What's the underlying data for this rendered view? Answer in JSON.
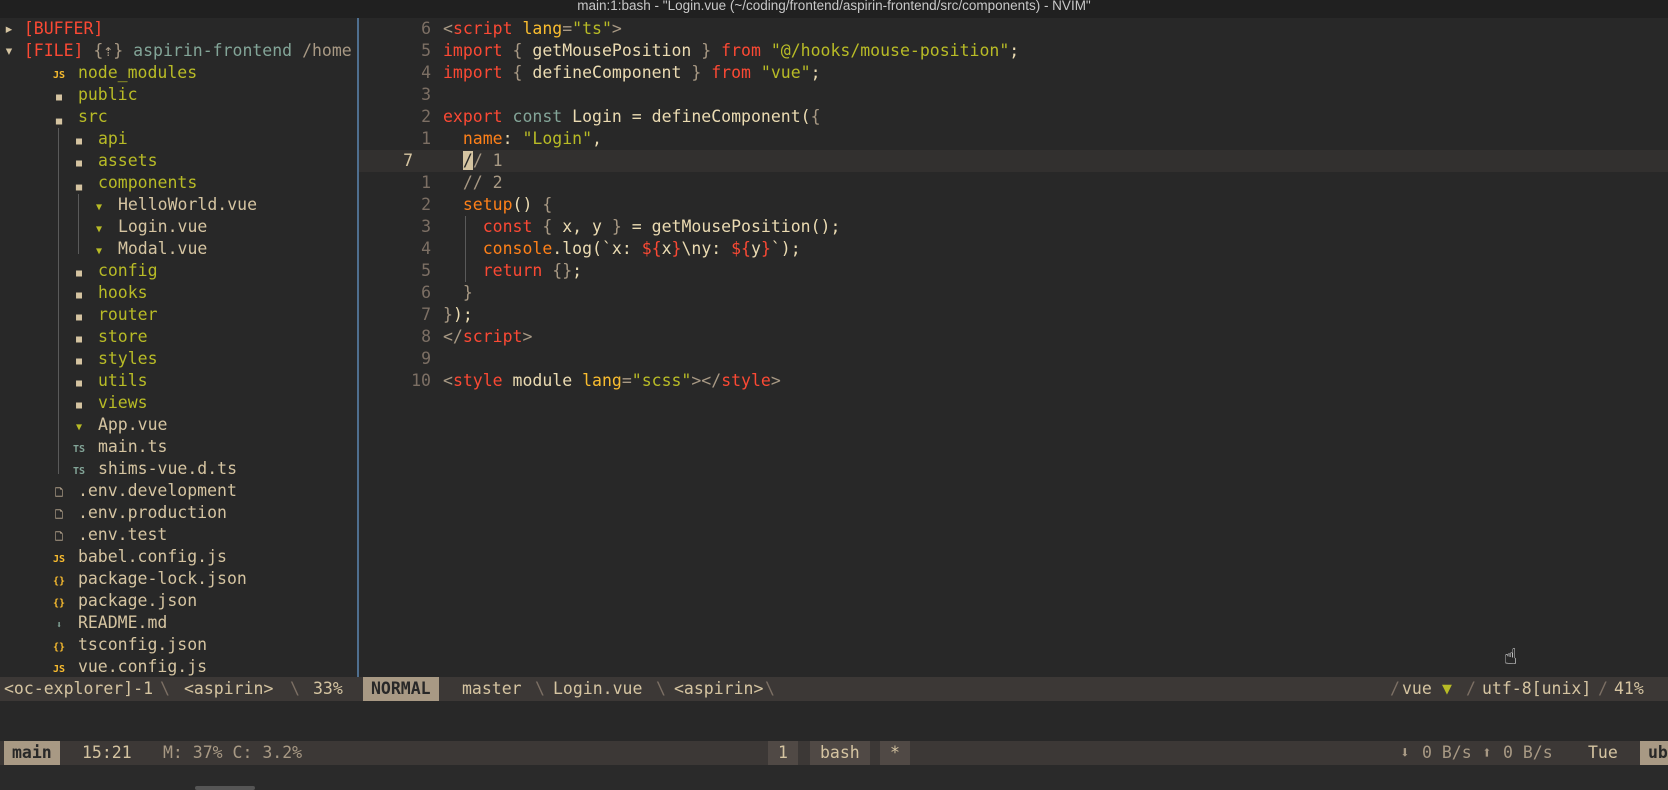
{
  "titlebar": {
    "title": "main:1:bash - \"Login.vue (~/coding/frontend/aspirin-frontend/src/components) - NVIM\""
  },
  "explorer": {
    "buffer_label": "[BUFFER]",
    "file_label": "[FILE]",
    "file_flags": "{⇡}",
    "project": "aspirin-frontend",
    "project_path": "/home",
    "items": [
      {
        "name": "node_modules",
        "icon": "JS",
        "kind": "js-folder"
      },
      {
        "name": "public",
        "icon": "folder-icon",
        "kind": "folder"
      },
      {
        "name": "src",
        "icon": "folder-open-icon",
        "kind": "folder"
      },
      {
        "name": "api",
        "icon": "folder-icon",
        "kind": "folder"
      },
      {
        "name": "assets",
        "icon": "folder-icon",
        "kind": "folder"
      },
      {
        "name": "components",
        "icon": "folder-open-icon",
        "kind": "folder"
      },
      {
        "name": "HelloWorld.vue",
        "icon": "vue-icon",
        "kind": "vue"
      },
      {
        "name": "Login.vue",
        "icon": "vue-icon",
        "kind": "vue"
      },
      {
        "name": "Modal.vue",
        "icon": "vue-icon",
        "kind": "vue"
      },
      {
        "name": "config",
        "icon": "folder-icon",
        "kind": "folder"
      },
      {
        "name": "hooks",
        "icon": "folder-icon",
        "kind": "folder"
      },
      {
        "name": "router",
        "icon": "folder-icon",
        "kind": "folder"
      },
      {
        "name": "store",
        "icon": "folder-icon",
        "kind": "folder"
      },
      {
        "name": "styles",
        "icon": "folder-icon",
        "kind": "folder"
      },
      {
        "name": "utils",
        "icon": "folder-icon",
        "kind": "folder"
      },
      {
        "name": "views",
        "icon": "folder-icon",
        "kind": "folder"
      },
      {
        "name": "App.vue",
        "icon": "vue-icon",
        "kind": "vue"
      },
      {
        "name": "main.ts",
        "icon": "TS",
        "kind": "ts"
      },
      {
        "name": "shims-vue.d.ts",
        "icon": "TS",
        "kind": "ts"
      },
      {
        "name": ".env.development",
        "icon": "file-icon",
        "kind": "file"
      },
      {
        "name": ".env.production",
        "icon": "file-icon",
        "kind": "file"
      },
      {
        "name": ".env.test",
        "icon": "file-icon",
        "kind": "file"
      },
      {
        "name": "babel.config.js",
        "icon": "JS",
        "kind": "js"
      },
      {
        "name": "package-lock.json",
        "icon": "{}",
        "kind": "json"
      },
      {
        "name": "package.json",
        "icon": "{}",
        "kind": "json"
      },
      {
        "name": "README.md",
        "icon": "markdown-icon",
        "kind": "md"
      },
      {
        "name": "tsconfig.json",
        "icon": "{}",
        "kind": "json"
      },
      {
        "name": "vue.config.js",
        "icon": "JS",
        "kind": "js"
      }
    ]
  },
  "editor": {
    "lines": [
      {
        "num": "6",
        "tokens": [
          [
            "<",
            "sym"
          ],
          [
            "script",
            "tag"
          ],
          [
            " lang",
            "attr"
          ],
          [
            "=",
            "sym"
          ],
          [
            "\"ts\"",
            "str"
          ],
          [
            ">",
            "sym"
          ]
        ]
      },
      {
        "num": "5",
        "tokens": [
          [
            "import",
            "kw"
          ],
          [
            " ",
            "t"
          ],
          [
            "{",
            "sym"
          ],
          [
            " getMousePosition ",
            "t"
          ],
          [
            "}",
            "sym"
          ],
          [
            " from ",
            "kw"
          ],
          [
            "\"@/hooks/mouse-position\"",
            "str"
          ],
          [
            ";",
            "t"
          ]
        ]
      },
      {
        "num": "4",
        "tokens": [
          [
            "import",
            "kw"
          ],
          [
            " ",
            "t"
          ],
          [
            "{",
            "sym"
          ],
          [
            " defineComponent ",
            "t"
          ],
          [
            "}",
            "sym"
          ],
          [
            " from ",
            "kw"
          ],
          [
            "\"vue\"",
            "str"
          ],
          [
            ";",
            "t"
          ]
        ]
      },
      {
        "num": "3",
        "tokens": []
      },
      {
        "num": "2",
        "tokens": [
          [
            "export",
            "kw"
          ],
          [
            " const ",
            "kw2"
          ],
          [
            "Login ",
            "t"
          ],
          [
            "=",
            "t"
          ],
          [
            " defineComponent(",
            "t"
          ],
          [
            "{",
            "sym"
          ]
        ]
      },
      {
        "num": "1",
        "tokens": [
          [
            "  ",
            "t"
          ],
          [
            "name",
            "prop"
          ],
          [
            ": ",
            "t"
          ],
          [
            "\"Login\"",
            "str"
          ],
          [
            ",",
            "t"
          ]
        ]
      },
      {
        "num": "7",
        "current": true,
        "tokens": [
          [
            "  ",
            "t"
          ],
          [
            "/",
            "cursor"
          ],
          [
            "/ 1",
            "cmt"
          ]
        ]
      },
      {
        "num": "1",
        "tokens": [
          [
            "  ",
            "t"
          ],
          [
            "// 2",
            "cmt"
          ]
        ]
      },
      {
        "num": "2",
        "tokens": [
          [
            "  ",
            "t"
          ],
          [
            "setup",
            "prop"
          ],
          [
            "() ",
            "t"
          ],
          [
            "{",
            "sym"
          ]
        ]
      },
      {
        "num": "3",
        "guide": true,
        "tokens": [
          [
            "const ",
            "kw"
          ],
          [
            "{",
            "sym"
          ],
          [
            " x, y ",
            "t"
          ],
          [
            "}",
            "sym"
          ],
          [
            " = getMousePosition();",
            "t"
          ]
        ]
      },
      {
        "num": "4",
        "guide": true,
        "tokens": [
          [
            "console",
            "prop"
          ],
          [
            ".log(`x: ",
            "t"
          ],
          [
            "${",
            "kw"
          ],
          [
            "x",
            "t"
          ],
          [
            "}",
            "kw"
          ],
          [
            "\\ny: ",
            "t"
          ],
          [
            "${",
            "kw"
          ],
          [
            "y",
            "t"
          ],
          [
            "}",
            "kw"
          ],
          [
            "`);",
            "t"
          ]
        ]
      },
      {
        "num": "5",
        "guide": true,
        "tokens": [
          [
            "return ",
            "kw"
          ],
          [
            "{}",
            "sym"
          ],
          [
            ";",
            "t"
          ]
        ]
      },
      {
        "num": "6",
        "tokens": [
          [
            "  ",
            "t"
          ],
          [
            "}",
            "sym"
          ]
        ]
      },
      {
        "num": "7",
        "tokens": [
          [
            "}",
            "sym"
          ],
          [
            ");",
            "t"
          ]
        ]
      },
      {
        "num": "8",
        "tokens": [
          [
            "</",
            "sym"
          ],
          [
            "script",
            "tag"
          ],
          [
            ">",
            "sym"
          ]
        ]
      },
      {
        "num": "9",
        "tokens": []
      },
      {
        "num": "10",
        "tokens": [
          [
            "<",
            "sym"
          ],
          [
            "style",
            "tag"
          ],
          [
            " module",
            "t"
          ],
          [
            " lang",
            "attr"
          ],
          [
            "=",
            "sym"
          ],
          [
            "\"scss\"",
            "str"
          ],
          [
            "></",
            "sym"
          ],
          [
            "style",
            "tag"
          ],
          [
            ">",
            "sym"
          ]
        ]
      }
    ]
  },
  "statusline": {
    "left_explorer": "<oc-explorer]-1",
    "left_project": "<aspirin>",
    "left_percent": "33%",
    "mode": "NORMAL",
    "branch": "master",
    "file": "Login.vue",
    "project": "<aspirin>",
    "filetype": "vue",
    "filetype_icon": "vue-icon",
    "encoding": "utf-8[unix]",
    "percent": "41%"
  },
  "tmux": {
    "session": "main",
    "time": "15:21",
    "stats": "M: 37% C: 3.2%",
    "window_index": "1",
    "window_name": "bash",
    "window_flag": "*",
    "net_down": "0 B/s",
    "net_up": "0 B/s",
    "day": "Tue",
    "host": "ubu"
  },
  "colors": {
    "bg": "#282828",
    "fg": "#ebdbb2",
    "red": "#fb4934",
    "green": "#b8bb26",
    "yellow": "#fabd2f",
    "blue": "#83a598",
    "aqua": "#8ec07c",
    "orange": "#fe8019",
    "gray": "#a89984"
  }
}
